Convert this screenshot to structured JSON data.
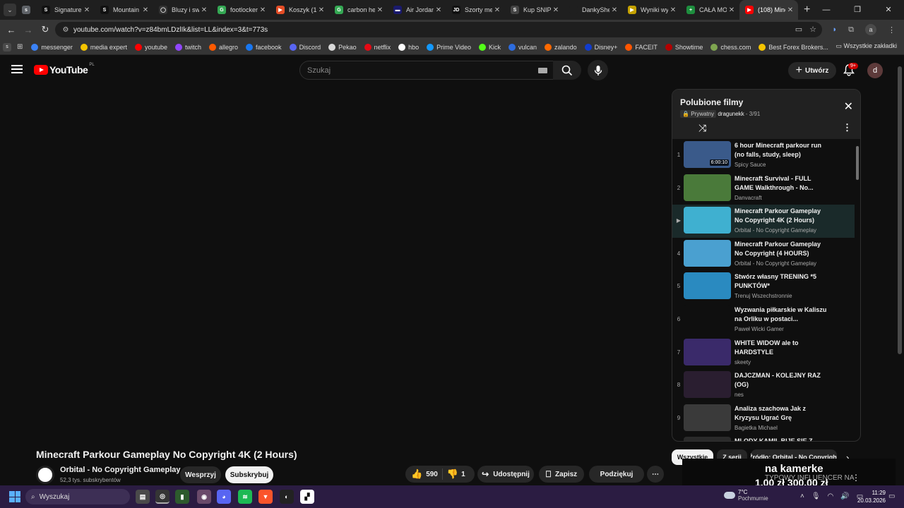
{
  "browser": {
    "tabs": [
      {
        "title": "",
        "favicon": "s",
        "color": "#5f6368"
      },
      {
        "title": "Signature",
        "favicon": "S",
        "color": "#111111"
      },
      {
        "title": "Mountain",
        "favicon": "S",
        "color": "#111111"
      },
      {
        "title": "Bluzy i sw",
        "favicon": "◯",
        "color": "#333333"
      },
      {
        "title": "footlocker",
        "favicon": "G",
        "color": "#34a853"
      },
      {
        "title": "Koszyk (1",
        "favicon": "▶",
        "color": "#e44d26"
      },
      {
        "title": "carbon he",
        "favicon": "G",
        "color": "#34a853"
      },
      {
        "title": "Air Jordan",
        "favicon": "▬",
        "color": "#1a1a6e"
      },
      {
        "title": "Szorty me",
        "favicon": "JD",
        "color": "#111111"
      },
      {
        "title": "Kup SNIPE",
        "favicon": "S",
        "color": "#444444"
      },
      {
        "title": "DankyShe",
        "favicon": "",
        "color": "#1f1f1f"
      },
      {
        "title": "Wyniki wy",
        "favicon": "▶",
        "color": "#c4a100"
      },
      {
        "title": "CAŁA MO",
        "favicon": "+",
        "color": "#1e8e3e"
      },
      {
        "title": "(108) Mine",
        "favicon": "▶",
        "color": "#ff0000"
      }
    ],
    "url": "youtube.com/watch?v=z84bmLDzlIk&list=LL&index=3&t=773s",
    "profile": "a",
    "bookmarks": [
      {
        "label": "messenger",
        "color": "#3b82f6"
      },
      {
        "label": "media expert",
        "color": "#f5c400"
      },
      {
        "label": "youtube",
        "color": "#ff0000"
      },
      {
        "label": "twitch",
        "color": "#9146ff"
      },
      {
        "label": "allegro",
        "color": "#ff5a00"
      },
      {
        "label": "facebook",
        "color": "#1877f2"
      },
      {
        "label": "Discord",
        "color": "#5865f2"
      },
      {
        "label": "Pekao",
        "color": "#d9d9d9"
      },
      {
        "label": "netflix",
        "color": "#e50914"
      },
      {
        "label": "hbo",
        "color": "#ffffff"
      },
      {
        "label": "Prime Video",
        "color": "#1399ff"
      },
      {
        "label": "Kick",
        "color": "#53fc18"
      },
      {
        "label": "vulcan",
        "color": "#2d6cdf"
      },
      {
        "label": "zalando",
        "color": "#ff6900"
      },
      {
        "label": "Disney+",
        "color": "#113ccf"
      },
      {
        "label": "FACEIT",
        "color": "#ff5500"
      },
      {
        "label": "Showtime",
        "color": "#b30000"
      },
      {
        "label": "chess.com",
        "color": "#7fa650"
      },
      {
        "label": "Best Forex Brokers...",
        "color": "#f5c400"
      }
    ],
    "all_bookmarks": "Wszystkie zakładki"
  },
  "youtube": {
    "logo_text": "YouTube",
    "region": "PL",
    "search_placeholder": "Szukaj",
    "create_label": "Utwórz",
    "notif_badge": "9+",
    "avatar_letter": "d",
    "video": {
      "title": "Minecraft Parkour Gameplay No Copyright 4K (2 Hours)",
      "channel": "Orbital - No Copyright Gameplay",
      "subscribers": "52,3 tys. subskrybentów",
      "support_label": "Wesprzyj",
      "subscribe_label": "Subskrybuj",
      "likes": "590",
      "dislikes": "1",
      "share_label": "Udostępnij",
      "save_label": "Zapisz",
      "thanks_label": "Podziękuj"
    },
    "playlist": {
      "title": "Polubione filmy",
      "privacy": "Prywatny",
      "owner": "dragunekk",
      "position": "- 3/91",
      "items": [
        {
          "index": "1",
          "title": "6 hour Minecraft parkour run (no falls, study, sleep)",
          "channel": "Spicy Sauce",
          "duration": "6:00:10",
          "thumb": "#3a5a8a"
        },
        {
          "index": "2",
          "title": "Minecraft Survival - FULL GAME Walkthrough - No...",
          "channel": "Danvacraft",
          "duration": "",
          "thumb": "#4a7a3a"
        },
        {
          "index": "▶",
          "title": "Minecraft Parkour Gameplay No Copyright 4K (2 Hours)",
          "channel": "Orbital - No Copyright Gameplay",
          "duration": "",
          "thumb": "#3fb0d0"
        },
        {
          "index": "4",
          "title": "Minecraft Parkour Gameplay No Copyright (4 HOURS)",
          "channel": "Orbital - No Copyright Gameplay",
          "duration": "",
          "thumb": "#4aa0d0"
        },
        {
          "index": "5",
          "title": "Stwórz własny TRENING *5 PUNKTÓW*",
          "channel": "Trenuj Wszechstronnie",
          "duration": "",
          "thumb": "#2a8ac0"
        },
        {
          "index": "6",
          "title": "Wyzwania piłkarskie w Kaliszu na Orliku w postaci...",
          "channel": "Paweł Wicki Gamer",
          "duration": "",
          "thumb": "#0f0f0f"
        },
        {
          "index": "7",
          "title": "WHITE WIDOW ale to HARDSTYLE",
          "channel": "skeety",
          "duration": "",
          "thumb": "#3a2a6a"
        },
        {
          "index": "8",
          "title": "DAJCZMAN - KOLEJNY RAZ (OG)",
          "channel": "nes",
          "duration": "",
          "thumb": "#2a1e30"
        },
        {
          "index": "9",
          "title": "Analiza szachowa Jak z Kryzysu Ugrać Grę",
          "channel": "Bagietka Michael",
          "duration": "",
          "thumb": "#3a3a3a"
        },
        {
          "index": "",
          "title": "MLODY KAMIL BIJE SIE Z",
          "channel": "",
          "duration": "",
          "thumb": "#2a2a2a"
        }
      ]
    },
    "chips": [
      "Wszystkie",
      "Z serii",
      "Źródło: Orbital - No Copyright"
    ],
    "ad": {
      "line1": "na kamerke",
      "line2": "TYPOWY INFLUENCER NA",
      "line3": "1,00 zł 300,00 zł"
    }
  },
  "taskbar": {
    "search_placeholder": "Wyszukaj",
    "weather_temp": "7°C",
    "weather_desc": "Pochmurnie",
    "time": "11:29",
    "date": "20.03.2026"
  }
}
